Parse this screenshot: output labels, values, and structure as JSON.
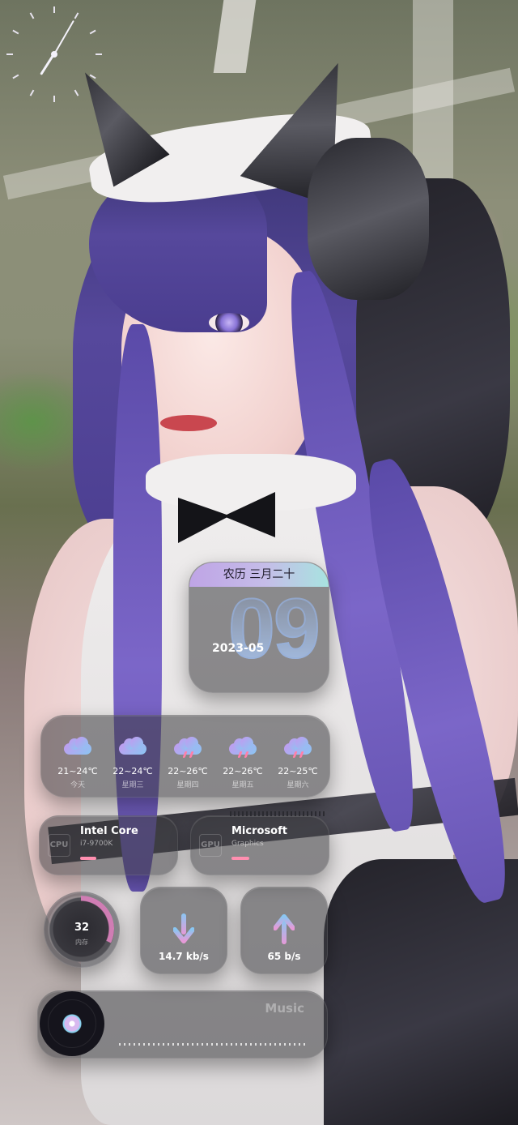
{
  "calendar": {
    "lunar": "农历 三月二十",
    "day": "09",
    "month": "2023-05"
  },
  "clock": {
    "hour": 7,
    "minute": 5
  },
  "weather": [
    {
      "temp": "21~24℃",
      "label": "今天",
      "icon": "cloud-icon"
    },
    {
      "temp": "22~24℃",
      "label": "星期三",
      "icon": "cloud-icon"
    },
    {
      "temp": "22~26℃",
      "label": "星期四",
      "icon": "rain-cloud-icon"
    },
    {
      "temp": "22~26℃",
      "label": "星期五",
      "icon": "rain-cloud-icon"
    },
    {
      "temp": "22~25℃",
      "label": "星期六",
      "icon": "rain-cloud-icon"
    }
  ],
  "cpu": {
    "chip": "CPU",
    "title": "Intel Core",
    "model": "i7-9700K"
  },
  "gpu": {
    "chip": "GPU",
    "title": "Microsoft",
    "model": "Graphics"
  },
  "memory": {
    "value": "32",
    "label": "内存",
    "fraction": 0.32
  },
  "network": {
    "download": "14.7 kb/s",
    "upload": "65 b/s"
  },
  "music": {
    "title": "Music"
  },
  "colors": {
    "accent_pink": "#ff8fb0",
    "accent_purple": "#c39af0",
    "accent_cyan": "#8ac6f2"
  }
}
